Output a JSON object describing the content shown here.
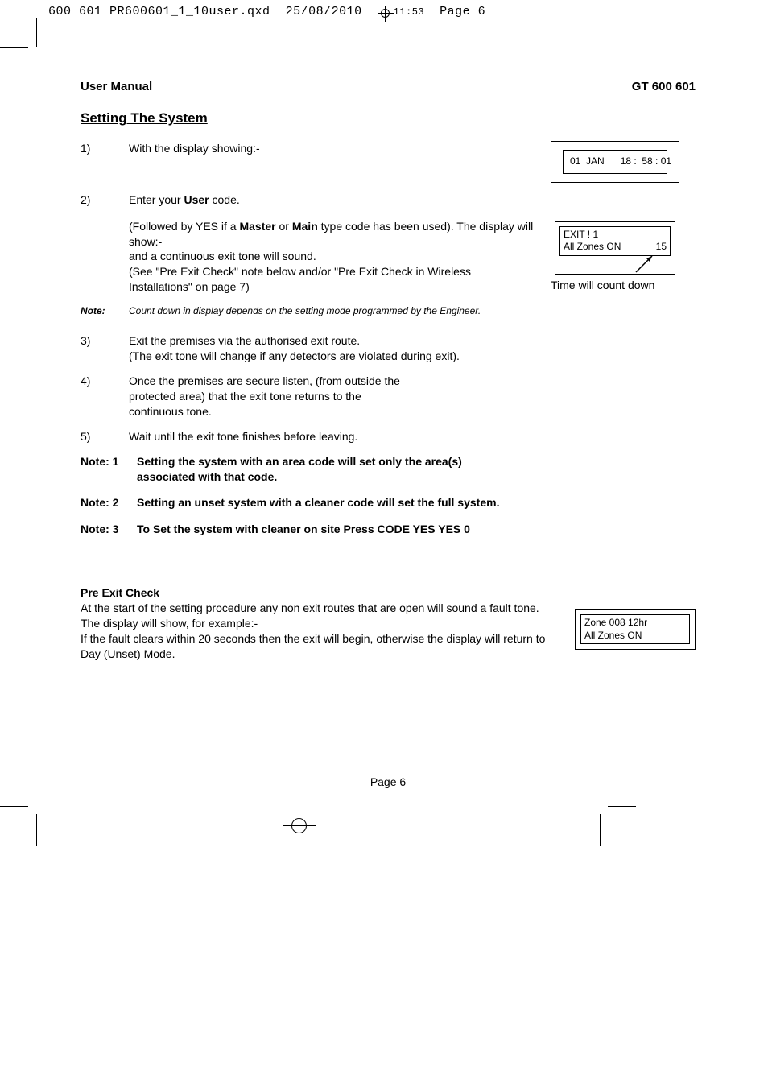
{
  "slug": {
    "file": "600 601 PR600601_1_10user.qxd",
    "date": "25/08/2010",
    "time": "11:53",
    "page": "Page 6"
  },
  "header": {
    "left": "User Manual",
    "right": "GT 600 601"
  },
  "section_title": "Setting The System",
  "step1": {
    "num": "1)",
    "text": "With the display showing:-"
  },
  "lcd1": {
    "line": "01  JAN      18 :  58 : 01"
  },
  "step2": {
    "num": "2)",
    "line1": "Enter your ",
    "bold1": "User",
    "line1b": " code.",
    "line2a": "(Followed by YES if a ",
    "bold2": "Master",
    "line2b": " or ",
    "bold3": "Main",
    "line2c": " type code has been used). The display will show:-",
    "line3": "and a continuous exit tone will sound.",
    "line4": "(See \"Pre Exit Check\" note below and/or \"Pre Exit Check in Wireless Installations\" on page 7)"
  },
  "lcd2": {
    "r1": "EXIT !   1",
    "r2a": "All Zones ON",
    "r2b": "15",
    "caption": "Time will count down"
  },
  "note": {
    "label": "Note:",
    "text": "Count down in display depends on the setting mode programmed by the Engineer."
  },
  "step3": {
    "num": "3)",
    "line1": "Exit the premises via the authorised exit route.",
    "line2": "(The exit tone will change if any detectors are violated during exit)."
  },
  "step4": {
    "num": "4)",
    "text": "Once the premises are secure listen, (from outside the protected area) that the exit tone returns to the continuous tone."
  },
  "step5": {
    "num": "5)",
    "text": "Wait until the exit tone finishes before leaving."
  },
  "bnote1": {
    "num": "Note: 1",
    "text": "Setting the system with an area code will set only the area(s) associated with that code."
  },
  "bnote2": {
    "num": "Note: 2",
    "text": "Setting an unset system with a cleaner code will set the full system."
  },
  "bnote3": {
    "num": "Note: 3",
    "text": "To Set the system with cleaner on site Press CODE YES YES 0"
  },
  "pre_exit": {
    "heading": "Pre Exit Check",
    "p1": "At the start of the setting procedure any non exit routes that are open will sound a fault tone. The display will show, for example:-",
    "p2": "If the fault clears within 20 seconds then the exit will begin, otherwise the display will return to Day (Unset) Mode."
  },
  "lcd3": {
    "r1": "Zone 008   12hr",
    "r2": "All  Zones  ON"
  },
  "page_num": "Page  6"
}
